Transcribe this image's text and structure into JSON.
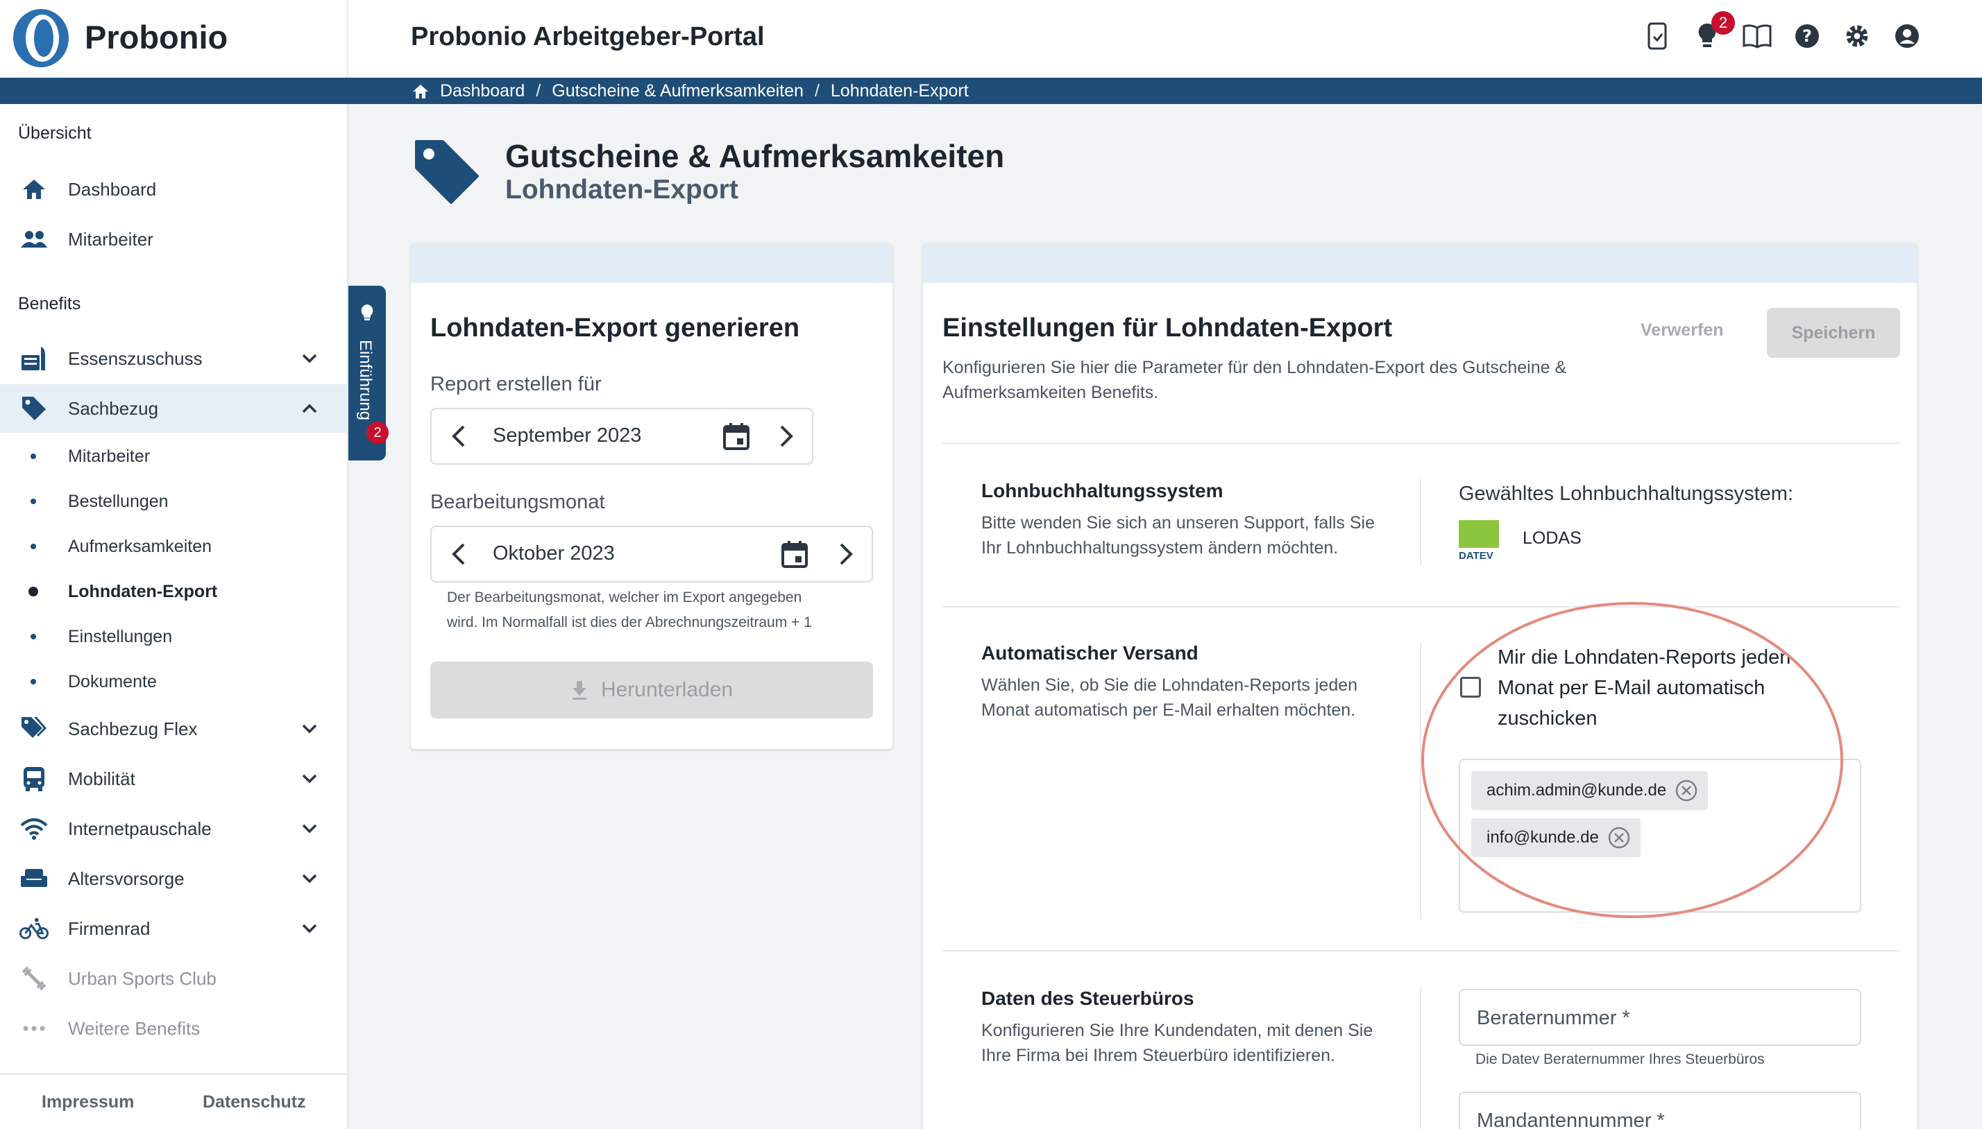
{
  "app": {
    "brand": "Probonio",
    "portal_title": "Probonio Arbeitgeber-Portal",
    "notification_count": "2",
    "icons": [
      "mobile-app-icon",
      "lightbulb-icon",
      "book-icon",
      "help-icon",
      "gear-icon",
      "account-icon"
    ]
  },
  "breadcrumb": {
    "items": [
      "Dashboard",
      "Gutscheine & Aufmerksamkeiten",
      "Lohndaten-Export"
    ],
    "separator": "/"
  },
  "sidebar": {
    "overview_label": "Übersicht",
    "overview_items": [
      {
        "label": "Dashboard",
        "icon": "home-icon"
      },
      {
        "label": "Mitarbeiter",
        "icon": "people-icon"
      }
    ],
    "benefits_label": "Benefits",
    "benefits": [
      {
        "label": "Essenszuschuss",
        "icon": "food-icon"
      },
      {
        "label": "Sachbezug",
        "icon": "tag-icon",
        "expanded": true
      },
      {
        "label": "Sachbezug Flex",
        "icon": "tags-icon"
      },
      {
        "label": "Mobilität",
        "icon": "bus-icon"
      },
      {
        "label": "Internetpauschale",
        "icon": "wifi-icon"
      },
      {
        "label": "Altersvorsorge",
        "icon": "sofa-icon"
      },
      {
        "label": "Firmenrad",
        "icon": "bike-icon"
      },
      {
        "label": "Urban Sports Club",
        "icon": "dumbbell-icon"
      },
      {
        "label": "Weitere Benefits",
        "icon": "more-icon"
      }
    ],
    "sachbezug_sub": [
      "Mitarbeiter",
      "Bestellungen",
      "Aufmerksamkeiten",
      "Lohndaten-Export",
      "Einstellungen",
      "Dokumente"
    ],
    "current_sub": "Lohndaten-Export",
    "footer": {
      "imprint": "Impressum",
      "privacy": "Datenschutz"
    }
  },
  "intro_tab": {
    "label": "Einführung",
    "count": "2"
  },
  "page": {
    "title": "Gutscheine & Aufmerksamkeiten",
    "subtitle": "Lohndaten-Export"
  },
  "export_card": {
    "title": "Lohndaten-Export generieren",
    "report_label": "Report erstellen für",
    "report_month": "September 2023",
    "processing_label": "Bearbeitungsmonat",
    "processing_month": "Oktober 2023",
    "processing_hint_1": "Der Bearbeitungsmonat, welcher im Export angegeben",
    "processing_hint_2": "wird. Im Normalfall ist dies der Abrechnungszeitraum + 1",
    "download_label": "Herunterladen"
  },
  "settings_card": {
    "title": "Einstellungen für Lohndaten-Export",
    "desc_1": "Konfigurieren Sie hier die Parameter für den Lohndaten-Export des Gutscheine &",
    "desc_2": "Aufmerksamkeiten Benefits.",
    "discard_label": "Verwerfen",
    "save_label": "Speichern",
    "payroll": {
      "title": "Lohnbuchhaltungssystem",
      "desc_1": "Bitte wenden Sie sich an unseren Support, falls Sie",
      "desc_2": "Ihr Lohnbuchhaltungssystem ändern möchten.",
      "selected_label": "Gewähltes Lohnbuchhaltungssystem:",
      "system": "LODAS",
      "logo_text": "DATEV",
      "logo_color": "#8cc63f"
    },
    "auto_send": {
      "title": "Automatischer Versand",
      "desc_1": "Wählen Sie, ob Sie die Lohndaten-Reports jeden",
      "desc_2": "Monat automatisch per E-Mail erhalten möchten.",
      "checkbox_label": "Mir die Lohndaten-Reports jeden Monat per E-Mail automatisch zuschicken",
      "checked": false,
      "emails": [
        "achim.admin@kunde.de",
        "info@kunde.de"
      ]
    },
    "tax_office": {
      "title": "Daten des Steuerbüros",
      "desc_1": "Konfigurieren Sie Ihre Kundendaten, mit denen Sie",
      "desc_2": "Ihre Firma bei Ihrem Steuerbüro identifizieren.",
      "advisor_label": "Beraternummer *",
      "advisor_hint": "Die Datev Beraternummer Ihres Steuerbüros",
      "client_label": "Mandantennummer *"
    }
  },
  "colors": {
    "primary": "#1e4d78",
    "badge": "#c8102e",
    "annotation": "#e48a7e"
  }
}
